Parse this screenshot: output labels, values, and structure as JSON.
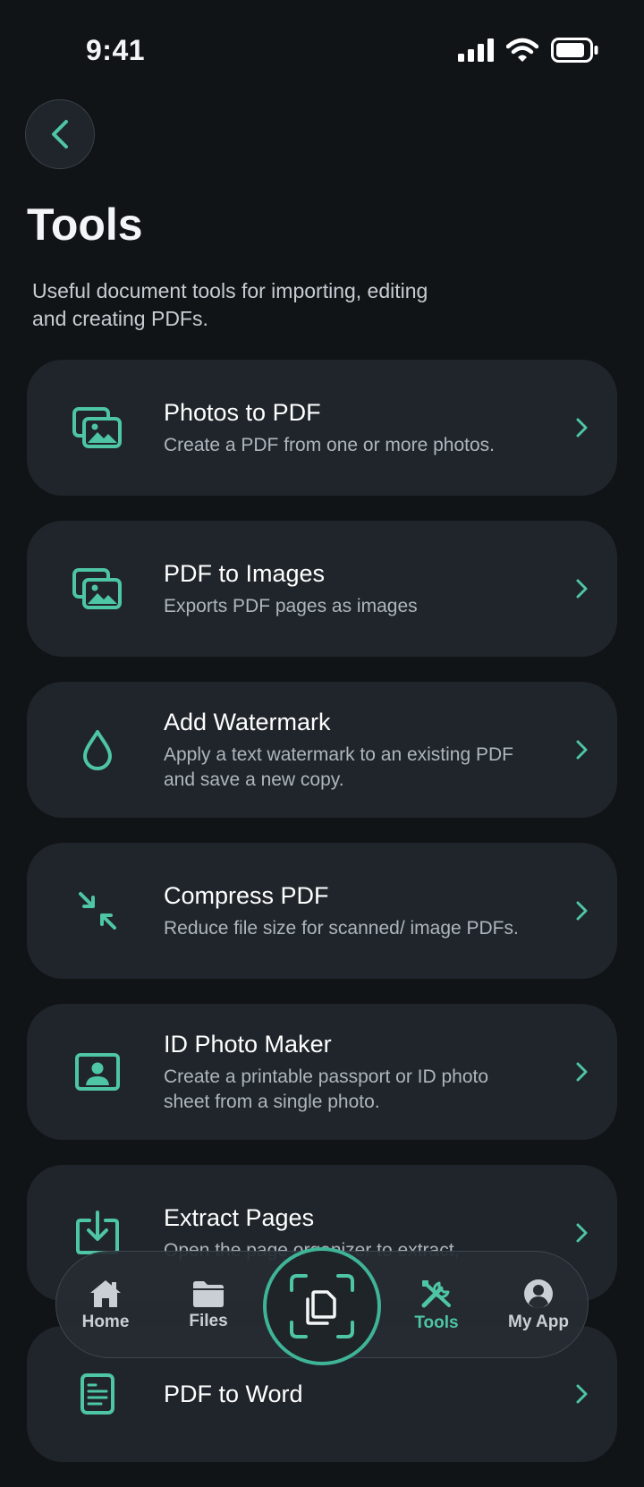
{
  "status": {
    "time": "9:41"
  },
  "header": {
    "title": "Tools",
    "subtitle": "Useful document tools for importing, editing and creating PDFs."
  },
  "tools": [
    {
      "title": "Photos to PDF",
      "desc": "Create a PDF from one or more photos.",
      "icon": "photos-icon"
    },
    {
      "title": "PDF to Images",
      "desc": "Exports PDF pages as images",
      "icon": "images-icon"
    },
    {
      "title": "Add Watermark",
      "desc": "Apply a text watermark to an existing PDF and save a new copy.",
      "icon": "droplet-icon"
    },
    {
      "title": "Compress PDF",
      "desc": "Reduce file size for scanned/ image PDFs.",
      "icon": "compress-icon"
    },
    {
      "title": "ID Photo Maker",
      "desc": "Create a printable passport or ID photo sheet from a single photo.",
      "icon": "id-photo-icon"
    },
    {
      "title": "Extract Pages",
      "desc": "Open the page organizer to extract,",
      "icon": "extract-icon"
    },
    {
      "title": "PDF to Word",
      "desc": "",
      "icon": "word-doc-icon"
    }
  ],
  "nav": {
    "home": "Home",
    "files": "Files",
    "tools": "Tools",
    "myapp": "My App",
    "active": "tools"
  },
  "colors": {
    "accent": "#4ec5a5",
    "background": "#111417",
    "card": "#1f252b"
  }
}
